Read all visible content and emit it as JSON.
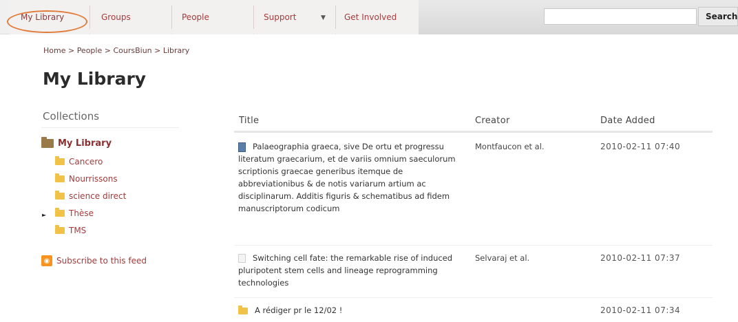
{
  "nav": {
    "tabs": [
      {
        "label": "My Library"
      },
      {
        "label": "Groups"
      },
      {
        "label": "People"
      },
      {
        "label": "Support"
      },
      {
        "label": "Get Involved"
      }
    ],
    "search_placeholder": "",
    "search_button": "Search"
  },
  "breadcrumb": "Home > People > CoursBiun > Library",
  "page_title": "My Library",
  "sidebar": {
    "title": "Collections",
    "root": "My Library",
    "items": [
      {
        "label": "Cancero"
      },
      {
        "label": "Nourrissons"
      },
      {
        "label": "science direct"
      },
      {
        "label": "Thèse"
      },
      {
        "label": "TMS"
      }
    ],
    "feed": "Subscribe to this feed"
  },
  "table": {
    "headers": {
      "title": "Title",
      "creator": "Creator",
      "date": "Date Added"
    },
    "rows": [
      {
        "icon": "book-icon",
        "title": "Palaeographia graeca, sive De ortu et progressu literatum graecarium, et de variis omnium saeculorum scriptionis graecae generibus itemque de abbreviationibus & de notis variarum artium ac disciplinarum. Additis figuris & schematibus ad fidem manuscriptorum codicum",
        "creator": "Montfaucon et al.",
        "date": "2010-02-11 07:40"
      },
      {
        "icon": "document-icon",
        "title": "Switching cell fate: the remarkable rise of induced pluripotent stem cells and lineage reprogramming technologies",
        "creator": "Selvaraj et al.",
        "date": "2010-02-11 07:37"
      },
      {
        "icon": "folder-icon",
        "title": "A rédiger pr le 12/02 !",
        "creator": "",
        "date": "2010-02-11 07:34"
      }
    ]
  }
}
